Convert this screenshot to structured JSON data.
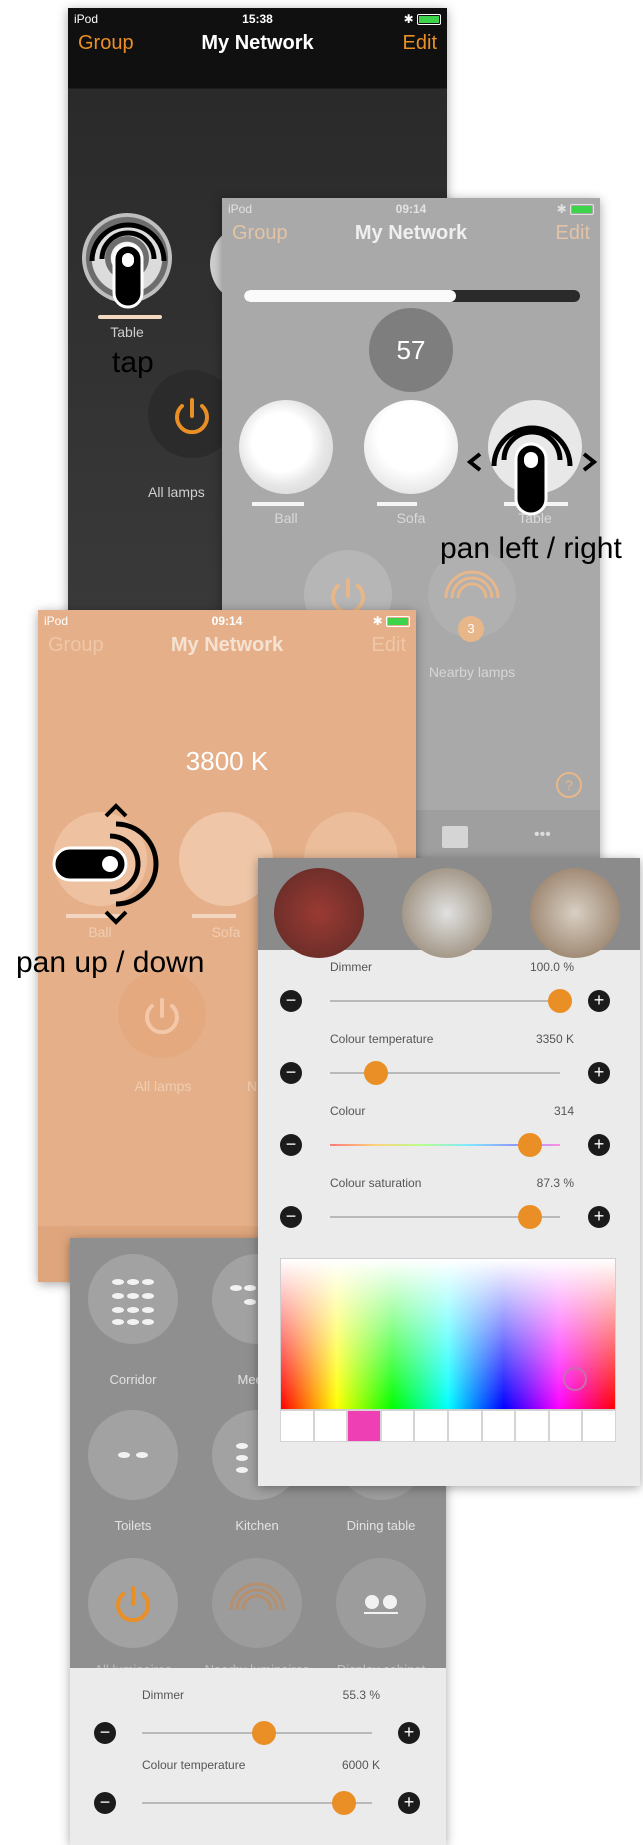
{
  "screen1": {
    "status": {
      "left": "iPod",
      "time": "15:38"
    },
    "nav": {
      "left": "Group",
      "title": "My Network",
      "right": "Edit"
    },
    "lamp_label": "Table",
    "all_lamps": "All lamps",
    "gesture": "tap"
  },
  "screen2": {
    "status": {
      "left": "iPod",
      "time": "09:14"
    },
    "nav": {
      "left": "Group",
      "title": "My Network",
      "right": "Edit"
    },
    "brightness_value": 0.63,
    "value_bubble": "57",
    "lamps": [
      "Ball",
      "Sofa",
      "Table"
    ],
    "nearby_count": "3",
    "nearby_label": "Nearby lamps",
    "help": "?",
    "more": "•••",
    "gesture": "pan left / right"
  },
  "screen3": {
    "status": {
      "left": "iPod",
      "time": "09:14"
    },
    "nav": {
      "left": "Group",
      "title": "My Network",
      "right": "Edit"
    },
    "color_temp": "3800 K",
    "lamps": [
      "Ball",
      "Sofa"
    ],
    "all_lamps": "All lamps",
    "nearby_partial": "Ne",
    "gesture": "pan up / down"
  },
  "screen4": {
    "sliders": [
      {
        "title": "Dimmer",
        "value": "100.0 %",
        "level": 1.0,
        "gradient": false
      },
      {
        "title": "Colour temperature",
        "value": "3350 K",
        "level": 0.2,
        "gradient": false
      },
      {
        "title": "Colour",
        "value": "314",
        "level": 0.87,
        "gradient": true
      },
      {
        "title": "Colour saturation",
        "value": "87.3 %",
        "level": 0.87,
        "gradient": false
      }
    ],
    "swatches": [
      "#ffffff",
      "#ffffff",
      "#ee3fb4",
      "#ffffff",
      "#ffffff",
      "#ffffff",
      "#ffffff",
      "#ffffff",
      "#ffffff",
      "#ffffff"
    ]
  },
  "screen5": {
    "groups": [
      "Corridor",
      "Meetin",
      "Toilets",
      "Kitchen",
      "Dining table"
    ],
    "bottom_partial": [
      "All luminaires",
      "Nearby luminaires",
      "Display cabinet"
    ],
    "sliders": [
      {
        "title": "Dimmer",
        "value": "55.3 %",
        "level": 0.53
      },
      {
        "title": "Colour temperature",
        "value": "6000 K",
        "level": 0.88
      }
    ]
  },
  "colors": {
    "accent": "#e98f25",
    "peach": "#e5b089",
    "dark": "#1b1b1b",
    "gray_screen": "#a9a9a9"
  }
}
